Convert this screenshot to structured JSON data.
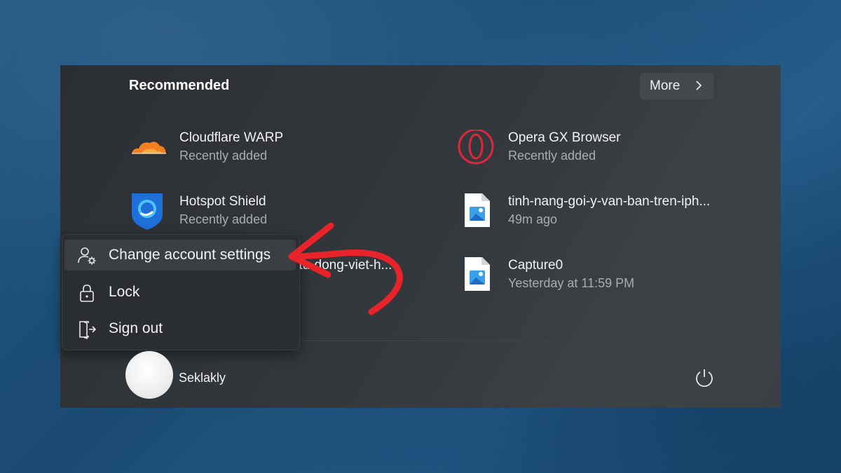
{
  "recommended": {
    "title": "Recommended",
    "more_label": "More",
    "items": [
      {
        "name": "Cloudflare WARP",
        "sub": "Recently added",
        "icon": "cloudflare-icon"
      },
      {
        "name": "Opera GX Browser",
        "sub": "Recently added",
        "icon": "opera-gx-icon"
      },
      {
        "name": "Hotspot Shield",
        "sub": "Recently added",
        "icon": "hotspot-shield-icon"
      },
      {
        "name": "tinh-nang-goi-y-van-ban-tren-iph...",
        "sub": "49m ago",
        "icon": "image-file-icon"
      },
      {
        "name": "-tu-dong-viet-h...",
        "sub": "",
        "icon": ""
      },
      {
        "name": "Capture0",
        "sub": "Yesterday at 11:59 PM",
        "icon": "image-file-icon"
      }
    ]
  },
  "account_menu": {
    "items": [
      {
        "label": "Change account settings",
        "icon": "account-settings-icon"
      },
      {
        "label": "Lock",
        "icon": "lock-icon"
      },
      {
        "label": "Sign out",
        "icon": "sign-out-icon"
      }
    ]
  },
  "user": {
    "name": "Seklakly"
  },
  "colors": {
    "accent_arrow": "#e8232a",
    "panel": "#2e3236"
  }
}
